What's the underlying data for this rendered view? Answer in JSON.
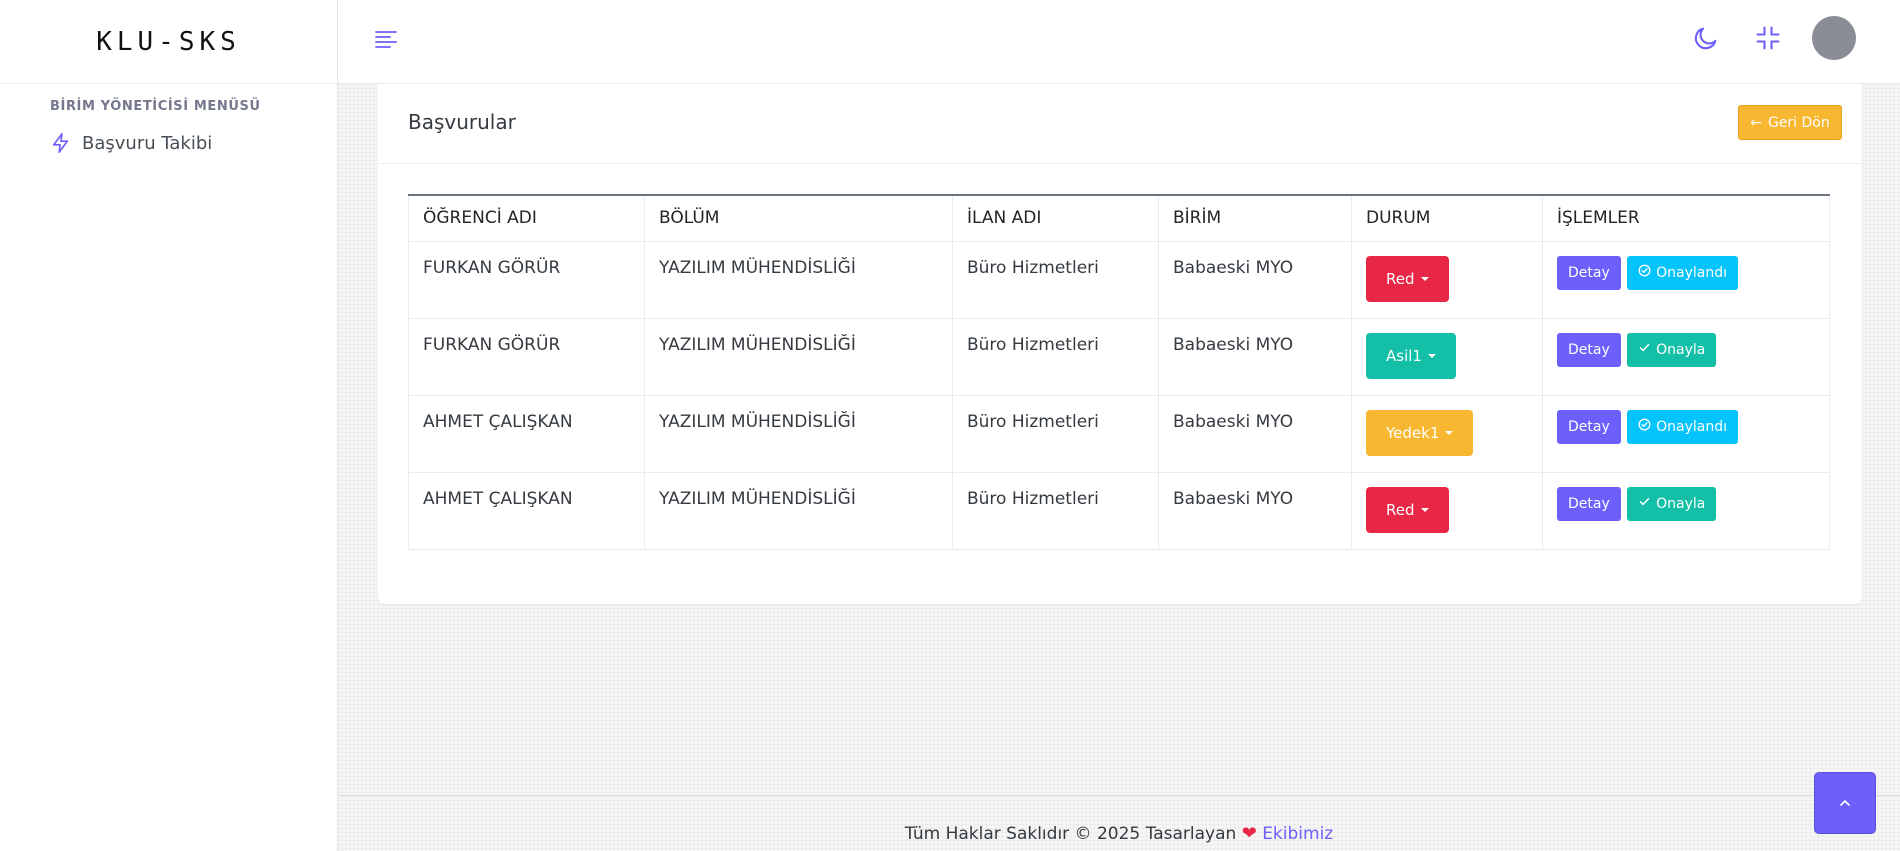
{
  "brand": "KLU-SKS",
  "sidebar": {
    "section_title": "BİRİM YÖNETİCİSİ MENÜSÜ",
    "items": [
      {
        "label": "Başvuru Takibi",
        "icon": "lightning-icon"
      }
    ]
  },
  "topbar": {
    "icons": [
      "menu-icon",
      "moon-icon",
      "fullscreen-exit-icon",
      "avatar"
    ],
    "accent_color": "#6c5ffc"
  },
  "card": {
    "title": "Başvurular",
    "back_button": "Geri Dön"
  },
  "table": {
    "headers": [
      "ÖĞRENCİ ADI",
      "BÖLÜM",
      "İLAN ADI",
      "BİRİM",
      "DURUM",
      "İŞLEMLER"
    ],
    "rows": [
      {
        "student": "FURKAN GÖRÜR",
        "department": "YAZILIM MÜHENDİSLİĞİ",
        "listing": "Büro Hizmetleri",
        "unit": "Babaeski MYO",
        "status": "Red",
        "status_color": "#e82646",
        "detail": "Detay",
        "action": "Onaylandı",
        "action_color": "#05c3fb",
        "action_icon": "check-circle-icon"
      },
      {
        "student": "FURKAN GÖRÜR",
        "department": "YAZILIM MÜHENDİSLİĞİ",
        "listing": "Büro Hizmetleri",
        "unit": "Babaeski MYO",
        "status": "Asil1",
        "status_color": "#13bfa6",
        "detail": "Detay",
        "action": "Onayla",
        "action_color": "#13bfa6",
        "action_icon": "check-icon"
      },
      {
        "student": "AHMET ÇALIŞKAN",
        "department": "YAZILIM MÜHENDİSLİĞİ",
        "listing": "Büro Hizmetleri",
        "unit": "Babaeski MYO",
        "status": "Yedek1",
        "status_color": "#f7b731",
        "detail": "Detay",
        "action": "Onaylandı",
        "action_color": "#05c3fb",
        "action_icon": "check-circle-icon"
      },
      {
        "student": "AHMET ÇALIŞKAN",
        "department": "YAZILIM MÜHENDİSLİĞİ",
        "listing": "Büro Hizmetleri",
        "unit": "Babaeski MYO",
        "status": "Red",
        "status_color": "#e82646",
        "detail": "Detay",
        "action": "Onayla",
        "action_color": "#13bfa6",
        "action_icon": "check-icon"
      }
    ]
  },
  "footer": {
    "text": "Tüm Haklar Saklıdır © 2025 Tasarlayan",
    "link": "Ekibimiz"
  }
}
